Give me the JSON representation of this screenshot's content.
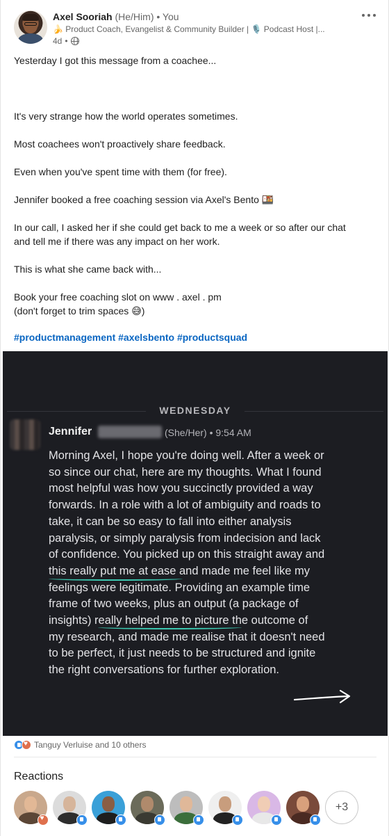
{
  "author": {
    "name": "Axel Sooriah",
    "pronouns": "(He/Him)",
    "you_label": "You",
    "headline": "🍌 Product Coach, Evangelist & Community Builder | 🎙️ Podcast Host |...",
    "age": "4d"
  },
  "post": {
    "lines": [
      "Yesterday I got this message from a coachee...",
      "It's very strange how the world operates sometimes.",
      "Most coachees won't proactively share feedback.",
      "Even when you've spent time with them (for free).",
      "Jennifer booked a free coaching session via Axel's Bento 🍱",
      "In our call, I asked her if she could get back to me a week or so after our chat",
      "and tell me if there was any impact on her work.",
      "This is what she came back with...",
      "Book your free coaching slot on www . axel . pm",
      "(don't forget to trim spaces 😅)"
    ],
    "hashtags": [
      "#productmanagement",
      "#axelsbento",
      "#productsquad"
    ]
  },
  "image": {
    "day": "WEDNESDAY",
    "sender": "Jennifer",
    "meta": "(She/Her) • 9:54 AM",
    "message_lines": [
      "Morning Axel, I hope you're doing well. After a week or",
      "so since our chat, here are my thoughts. What I found",
      "most helpful was how you succinctly provided a way",
      "forwards. In a role with a lot of ambiguity and roads to",
      "take, it can be so easy to fall into either analysis",
      "paralysis, or simply paralysis from indecision and lack",
      "of confidence. You picked up on this straight away and",
      "this really put me at ease and made me feel like my",
      "feelings were legitimate. Providing an example time",
      "frame of two weeks, plus an output (a package of",
      "insights) really helped me to picture the outcome of",
      "my research, and made me realise that it doesn't need",
      "to be perfect, it just needs to be structured and ignite",
      "the right conversations for further exploration."
    ]
  },
  "social": {
    "reactions_text": "Tanguy Verluise and 10 others",
    "reactions_heading": "Reactions",
    "more_count": "+3",
    "reactors": [
      {
        "bg": "#c9a88c",
        "skin": "#e2b896",
        "shirt": "#5b4636",
        "badge": "love"
      },
      {
        "bg": "#dcdcdc",
        "skin": "#d6b59b",
        "shirt": "#2d2d2d",
        "badge": "like"
      },
      {
        "bg": "#3aa0d8",
        "skin": "#8a5e44",
        "shirt": "#1e1e1e",
        "badge": "like"
      },
      {
        "bg": "#6b6b5a",
        "skin": "#b08a6c",
        "shirt": "#3a3a32",
        "badge": "like"
      },
      {
        "bg": "#bdbdbd",
        "skin": "#e0b899",
        "shirt": "#3b6e3b",
        "badge": "like"
      },
      {
        "bg": "#efefef",
        "skin": "#c89d7d",
        "shirt": "#222222",
        "badge": "like"
      },
      {
        "bg": "#d9b8e6",
        "skin": "#f0cdb5",
        "shirt": "#e8e8e8",
        "badge": "like"
      },
      {
        "bg": "#7a4a3a",
        "skin": "#d8a07c",
        "shirt": "#4a2a22",
        "badge": "like"
      }
    ]
  }
}
